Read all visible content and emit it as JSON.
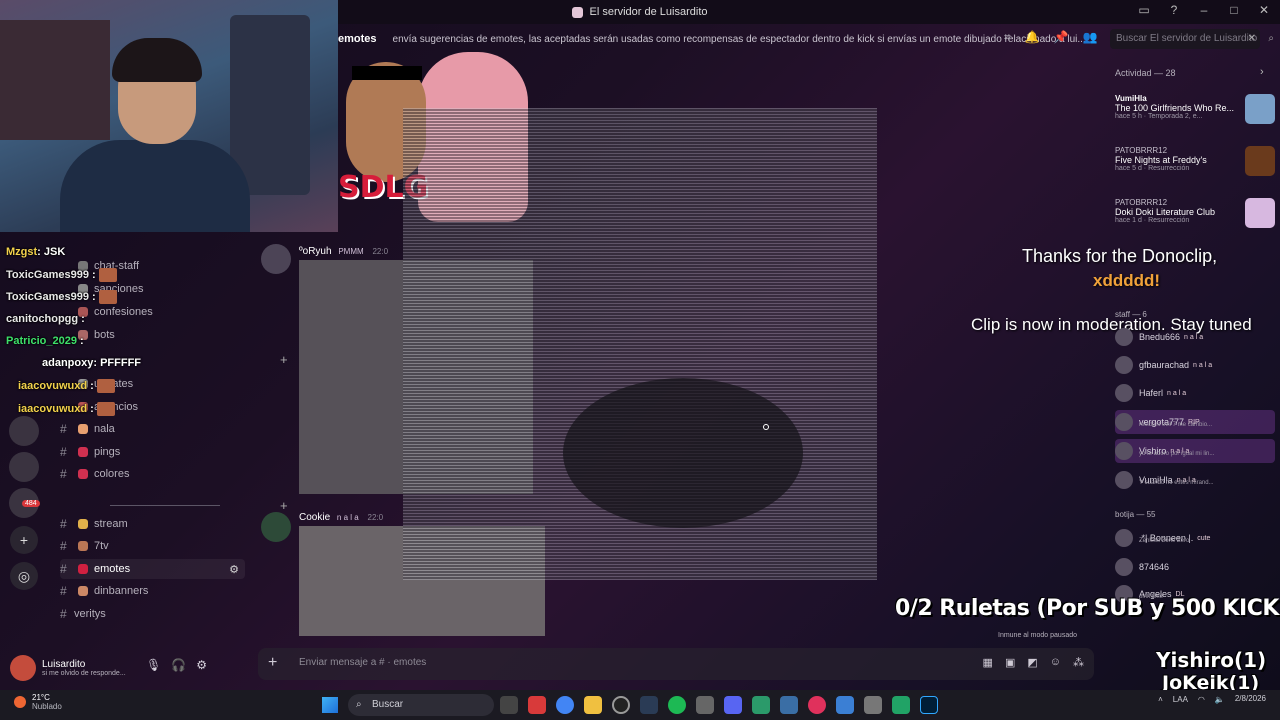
{
  "window": {
    "title": "El servidor de Luisardito"
  },
  "header": {
    "channel": "emotes",
    "topic": "envía sugerencias de emotes, las aceptadas serán usadas como recompensas de espectador dentro de kick si envías un emote dibujado relacionado a lui...",
    "search_placeholder": "Buscar El servidor de Luisardito",
    "icons": [
      "threads-icon",
      "bell-icon",
      "pin-icon",
      "members-icon"
    ]
  },
  "rail": {
    "badge": "484"
  },
  "channels": [
    {
      "label": "chat-staff"
    },
    {
      "label": "sanciones"
    },
    {
      "label": "confesiones"
    },
    {
      "label": "bots"
    },
    {
      "label": "updates"
    },
    {
      "label": "anuncios"
    },
    {
      "label": "nala"
    },
    {
      "label": "pings"
    },
    {
      "label": "colores"
    },
    {
      "label": "stream"
    },
    {
      "label": "7tv"
    },
    {
      "label": "emotes",
      "active": true
    },
    {
      "label": "dinbanners"
    },
    {
      "label": "veritys"
    }
  ],
  "stream_chat": [
    {
      "user": "Mzgst",
      "text": ": JSK",
      "color": "#f2d14c"
    },
    {
      "user": "ToxicGames999",
      "text": " :",
      "color": "#e8e8e8"
    },
    {
      "user": "ToxicGames999",
      "text": " :",
      "color": "#e8e8e8"
    },
    {
      "user": "canitochopgg",
      "text": " :",
      "color": "#e8e8e8"
    },
    {
      "user": "Patricio_2029",
      "text": " :",
      "color": "#3ee06a"
    },
    {
      "user": "adanpoxy",
      "text": ": PFFFFF",
      "color": "#ffffff"
    },
    {
      "user": "iaacovuwuxd",
      "text": " :",
      "color": "#f2d14c"
    },
    {
      "user": "iaacovuwuxd",
      "text": " :",
      "color": "#f2d14c"
    }
  ],
  "messages": [
    {
      "author": "ºoRyuh",
      "tag": "PMMM",
      "time": "22:0"
    },
    {
      "author": "Cookie",
      "tag": "n a l a",
      "time": "22:0"
    }
  ],
  "alert": {
    "line1": "Thanks for the Donoclip,",
    "line2": "xddddd!",
    "line3": "Clip is now in moderation. Stay tuned"
  },
  "activity": {
    "title": "Actividad — 28",
    "items": [
      {
        "user": "VumiHla",
        "title": "The 100 Girlfriends Who Re...",
        "sub": "hace 5 h · Temporada 2, e..."
      },
      {
        "user": "PATOBRRR12",
        "title": "Five Nights at Freddy's",
        "sub": "hace 5 d · Resurrección"
      },
      {
        "user": "PATOBRRR12",
        "title": "Doki Doki Literature Club",
        "sub": "hace 1 d · Resurrección"
      }
    ]
  },
  "members": {
    "staff_head": "staff — 6",
    "staff": [
      {
        "name": "Bnedu666",
        "tag": "n a l a"
      },
      {
        "name": "gfbaurachad",
        "tag": "n a l a"
      },
      {
        "name": "Haferl",
        "tag": "n a l a"
      },
      {
        "name": "vergota777",
        "tag": "RIP",
        "status": "resident evil 7 me cambio...",
        "hl": true
      },
      {
        "name": "Vishiro",
        "tag": "n a l a",
        "status": "yo te adoro por igual mi lin...",
        "hl": true
      },
      {
        "name": "VumiHla",
        "tag": "n a l a",
        "status": "Y cuando no estés mirand..."
      }
    ],
    "bots_head": "botija — 55",
    "bots": [
      {
        "name": ".*| Bonneen |.",
        "tag": "cute",
        "status": "Zenless Zone Zero"
      },
      {
        "name": "874646",
        "tag": ""
      },
      {
        "name": "Angeles",
        "tag": "DL",
        "status": "pink time"
      }
    ]
  },
  "overlay": {
    "roulette": "0/2 Ruletas (Por SUB y 500 KICKS)",
    "immune": "Inmune al modo pausado",
    "name1": "Yishiro(1)",
    "name2": "JoKeik(1)"
  },
  "user_panel": {
    "name": "Luisardito",
    "status": "si me olvido de responde..."
  },
  "composer": {
    "placeholder": "Enviar mensaje a # · emotes"
  },
  "taskbar": {
    "temp": "21°C",
    "condition": "Nublado",
    "search": "Buscar",
    "lang": "LAA",
    "date": "2/8/2026"
  }
}
